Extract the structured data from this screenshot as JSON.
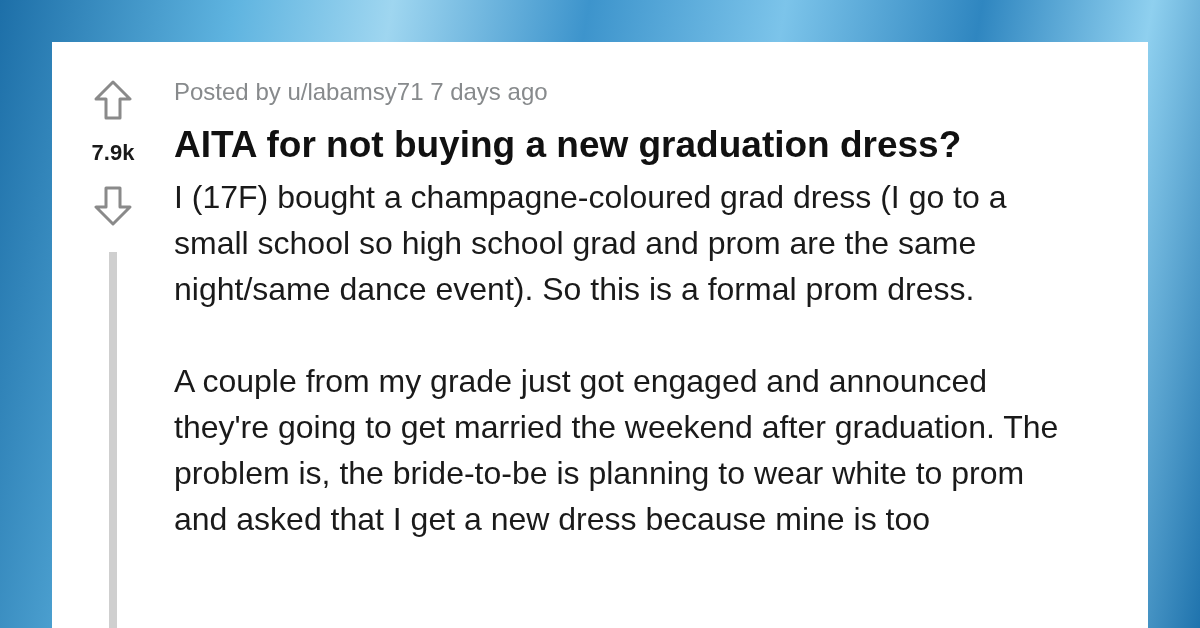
{
  "post": {
    "score": "7.9k",
    "meta": "Posted by u/labamsy71 7 days ago",
    "title": "AITA for not buying a new graduation dress?",
    "paragraphs": [
      "I (17F) bought a champagne-coloured grad dress (I go to a small school so high school grad and prom are the same night/same dance event). So this is a formal prom dress.",
      "A couple from my grade just got engaged and announced they're going to get married the weekend after graduation. The problem is, the bride-to-be is planning to wear white to prom and asked that I get a new dress because mine is too"
    ]
  }
}
